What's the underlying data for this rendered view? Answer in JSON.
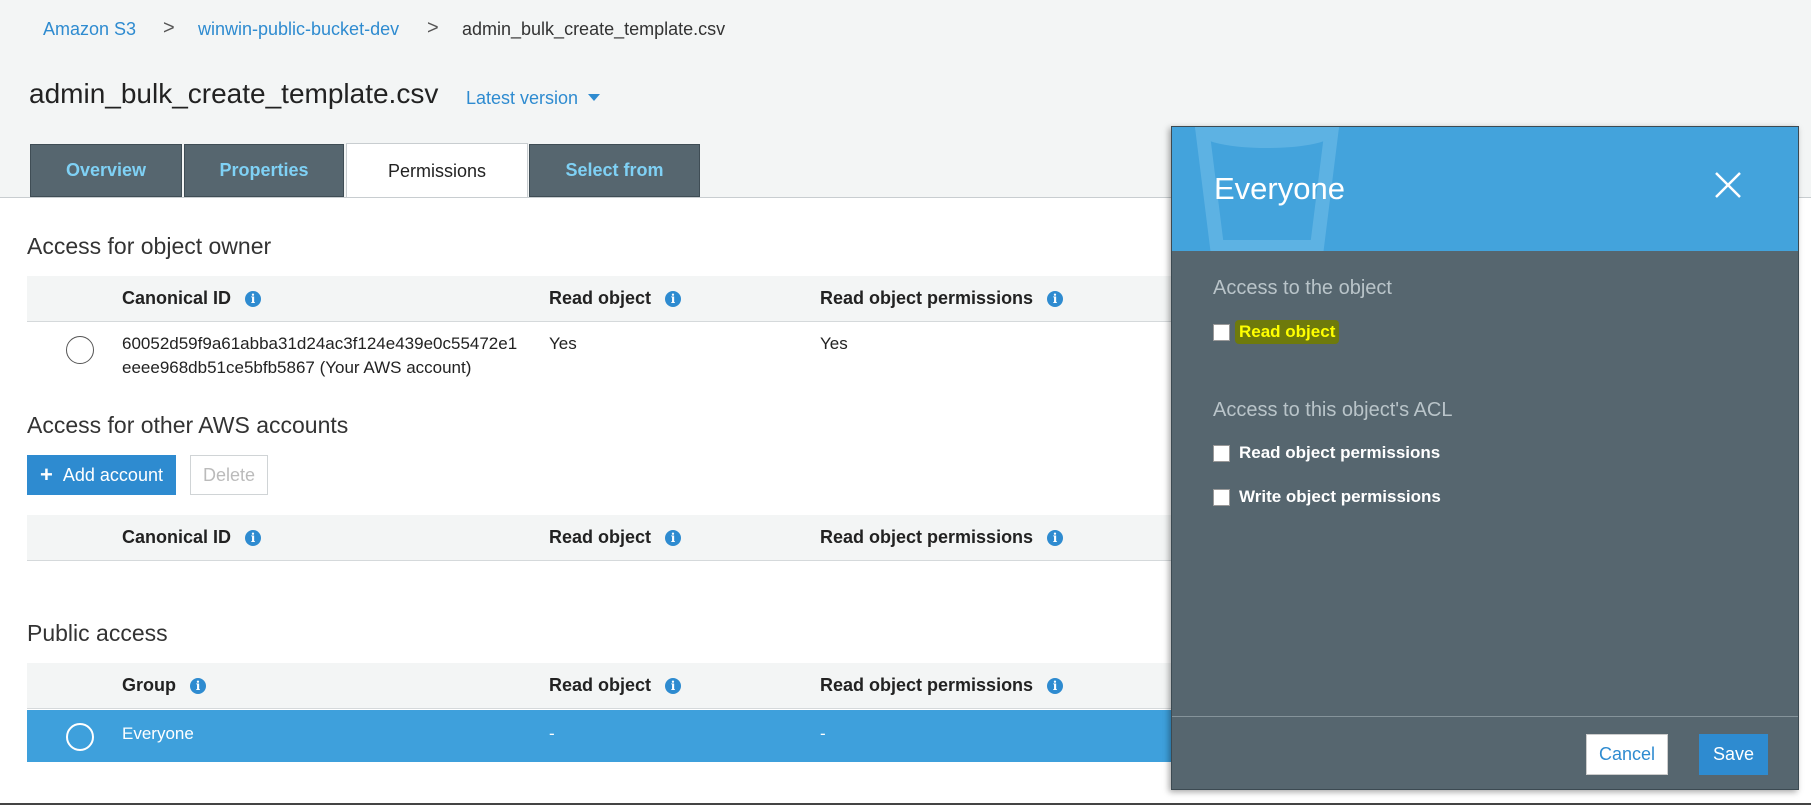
{
  "breadcrumb": {
    "items": [
      "Amazon S3",
      "winwin-public-bucket-dev",
      "admin_bulk_create_template.csv"
    ],
    "separator": ">"
  },
  "title": "admin_bulk_create_template.csv",
  "version_dropdown": "Latest version",
  "tabs": [
    {
      "label": "Overview",
      "active": false
    },
    {
      "label": "Properties",
      "active": false
    },
    {
      "label": "Permissions",
      "active": true
    },
    {
      "label": "Select from",
      "active": false
    }
  ],
  "owner_section": {
    "title": "Access for object owner",
    "columns": [
      "Canonical ID",
      "Read object",
      "Read object permissions"
    ],
    "row": {
      "canonical_id_line1": "60052d59f9a61abba31d24ac3f124e439e0c55472e1",
      "canonical_id_line2": "eeee968db51ce5bfb5867 (Your AWS account)",
      "read_object": "Yes",
      "read_permissions": "Yes"
    }
  },
  "other_accounts_section": {
    "title": "Access for other AWS accounts",
    "add_button": "Add account",
    "delete_button": "Delete",
    "columns": [
      "Canonical ID",
      "Read object",
      "Read object permissions"
    ]
  },
  "public_section": {
    "title": "Public access",
    "columns": [
      "Group",
      "Read object",
      "Read object permissions"
    ],
    "row": {
      "group": "Everyone",
      "read_object": "-",
      "read_permissions": "-"
    }
  },
  "panel": {
    "title": "Everyone",
    "object_section": "Access to the object",
    "read_object": "Read object",
    "acl_section": "Access to this object's ACL",
    "read_permissions": "Read object permissions",
    "write_permissions": "Write object permissions",
    "cancel": "Cancel",
    "save": "Save"
  },
  "colors": {
    "accent": "#2e8bd0",
    "tab_bg": "#56666f",
    "panel_bg": "#56666f",
    "panel_header": "#43a3dc",
    "highlight": "#ffff00"
  }
}
